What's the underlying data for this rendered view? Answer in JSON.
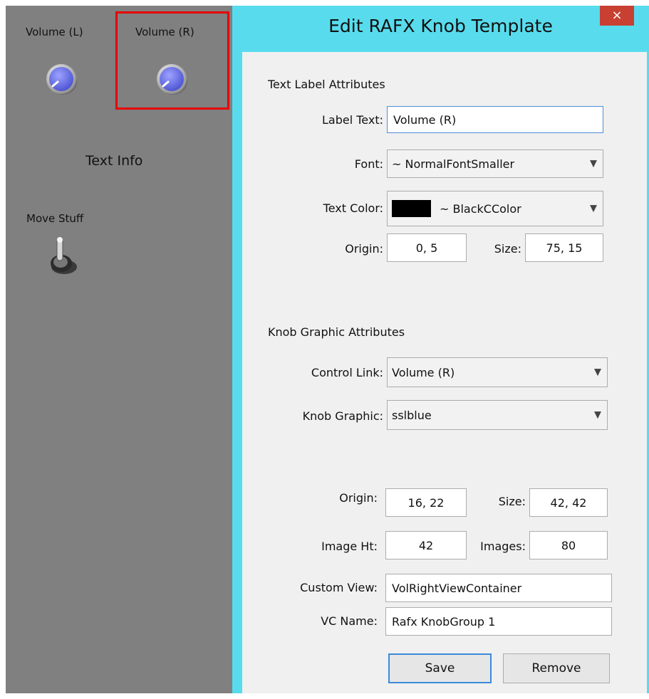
{
  "left_panel": {
    "knob_l_label": "Volume (L)",
    "knob_r_label": "Volume (R)",
    "text_info": "Text Info",
    "switch_label": "Move Stuff"
  },
  "dialog": {
    "title": "Edit RAFX Knob Template",
    "close_glyph": "×",
    "text_section": {
      "heading": "Text Label Attributes",
      "label_text_label": "Label Text:",
      "label_text_value": "Volume (R)",
      "font_label": "Font:",
      "font_value": "~ NormalFontSmaller",
      "text_color_label": "Text Color:",
      "text_color_value": "~ BlackCColor",
      "text_color_swatch": "#000000",
      "origin_label": "Origin:",
      "origin_value": "0, 5",
      "size_label": "Size:",
      "size_value": "75, 15"
    },
    "knob_section": {
      "heading": "Knob Graphic Attributes",
      "control_link_label": "Control Link:",
      "control_link_value": "Volume (R)",
      "knob_graphic_label": "Knob Graphic:",
      "knob_graphic_value": "sslblue",
      "origin_label": "Origin:",
      "origin_value": "16, 22",
      "size_label": "Size:",
      "size_value": "42, 42",
      "image_ht_label": "Image Ht:",
      "image_ht_value": "42",
      "images_label": "Images:",
      "images_value": "80",
      "custom_view_label": "Custom View:",
      "custom_view_value": "VolRightViewContainer",
      "vc_name_label": "VC Name:",
      "vc_name_value": "Rafx KnobGroup 1"
    },
    "buttons": {
      "save": "Save",
      "remove": "Remove"
    }
  },
  "colors": {
    "panel_gray": "#808080",
    "dialog_cyan": "#58dced",
    "selection_red": "#e60000",
    "knob_blue": "#6f74e3"
  }
}
